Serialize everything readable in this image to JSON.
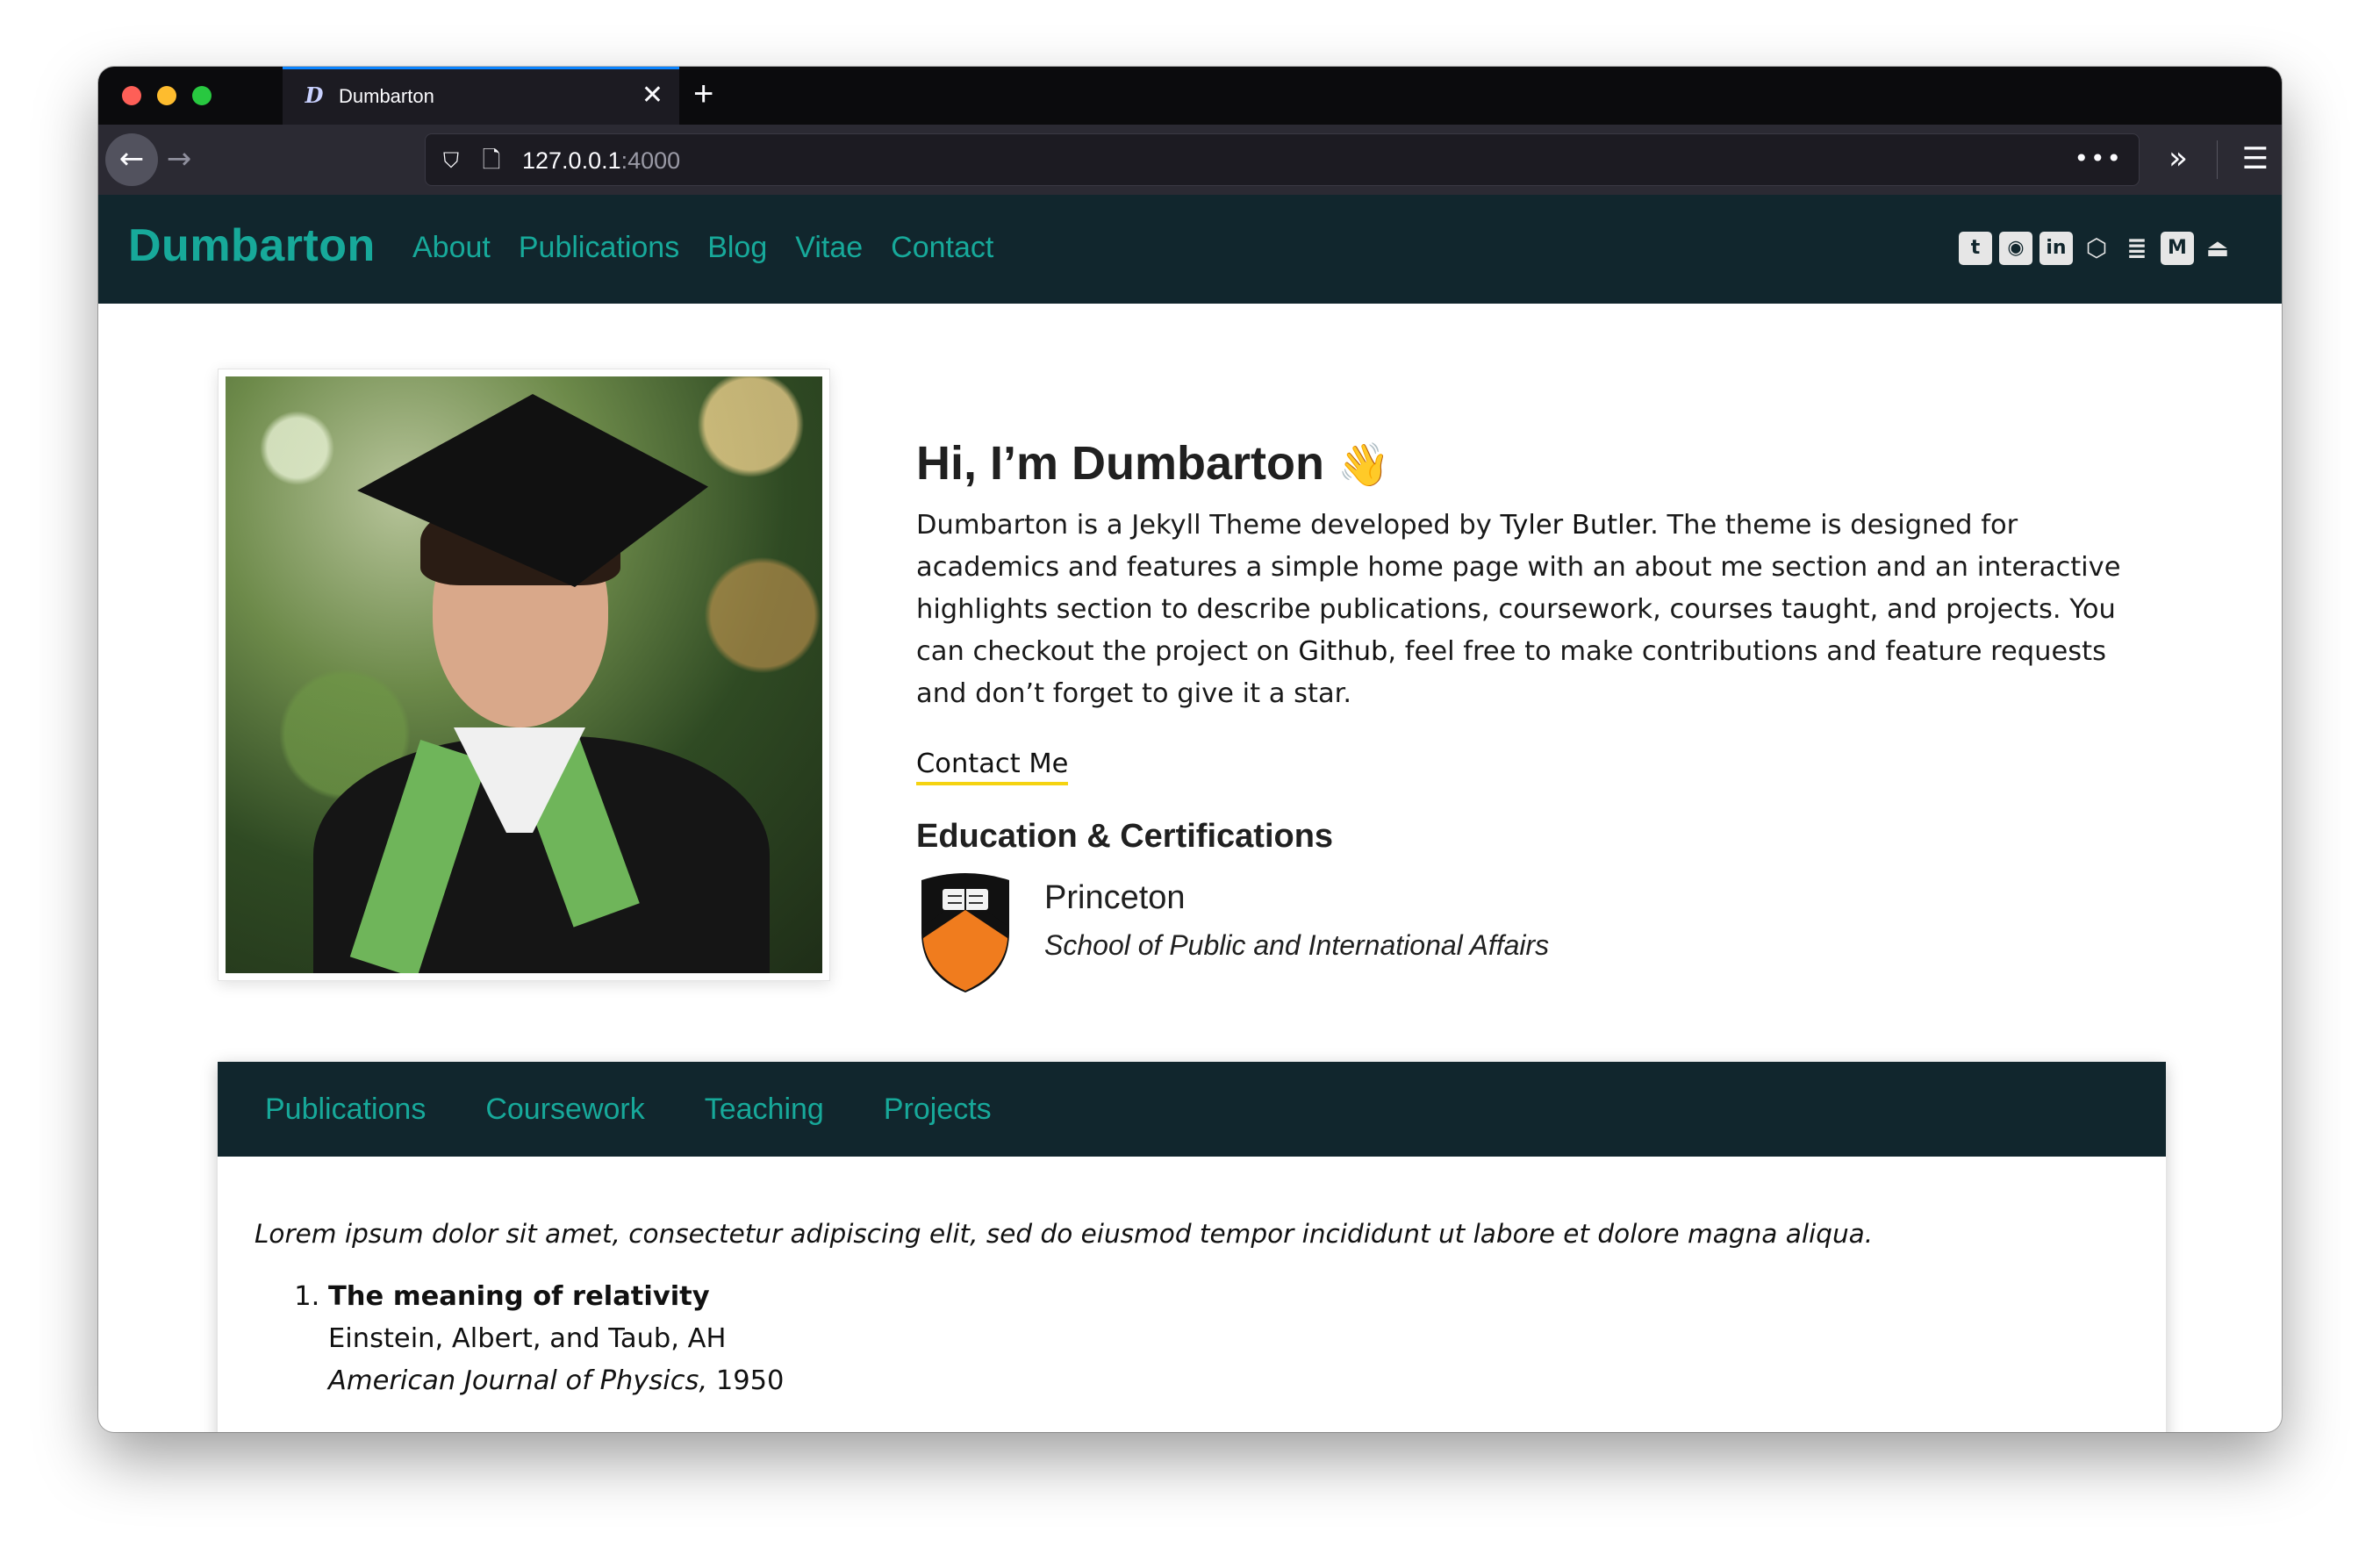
{
  "browser": {
    "tab_title": "Dumbarton",
    "tab_favicon": "D",
    "url_host": "127.0.0.1",
    "url_port": ":4000"
  },
  "site": {
    "brand": "Dumbarton",
    "nav": [
      "About",
      "Publications",
      "Blog",
      "Vitae",
      "Contact"
    ],
    "social_icons": [
      "twitter-icon",
      "github-icon",
      "linkedin-icon",
      "codepen-icon",
      "stackoverflow-icon",
      "medium-icon",
      "academia-icon"
    ],
    "colors": {
      "nav_bg": "#11262d",
      "accent": "#17a99a",
      "underline": "#f5d311"
    }
  },
  "profile": {
    "greeting": "Hi, I’m Dumbarton",
    "greeting_emoji": "👋",
    "desc_part1": "Dumbarton is a Jekyll Theme developed by ",
    "desc_link1": "Tyler Butler",
    "desc_part2": ". The theme is designed for academics and features a simple home page with an about me section and an interactive highlights section to describe publications, coursework, courses taught, and projects. You can checkout the project on ",
    "desc_link2": "Github",
    "desc_part3": ", feel free to make contributions and feature requests and don’t forget to give it a star.",
    "contact_label": "Contact Me",
    "education_title": "Education & Certifications",
    "education": [
      {
        "name": "Princeton",
        "school": "School of Public and International Affairs"
      }
    ]
  },
  "highlights": {
    "tabs": [
      "Publications",
      "Coursework",
      "Teaching",
      "Projects"
    ],
    "intro": "Lorem ipsum dolor sit amet, consectetur adipiscing elit, sed do eiusmod tempor incididunt ut labore et dolore magna aliqua.",
    "publications": [
      {
        "title": "The meaning of relativity",
        "authors": "Einstein, Albert, and Taub, AH",
        "venue": "American Journal of Physics,",
        "year": "1950"
      }
    ]
  }
}
